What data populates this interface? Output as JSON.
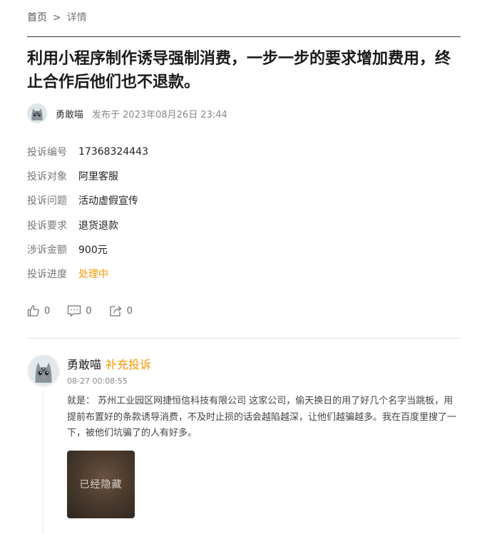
{
  "breadcrumb": {
    "home": "首页",
    "separator": ">",
    "current": "详情"
  },
  "title": "利用小程序制作诱导强制消费，一步一步的要求增加费用，终止合作后他们也不退款。",
  "author": {
    "name": "勇敢喵",
    "published_prefix": "发布于",
    "published_time": "2023年08月26日 23:44"
  },
  "info": [
    {
      "label": "投诉编号",
      "value": "17368324443"
    },
    {
      "label": "投诉对象",
      "value": "阿里客服"
    },
    {
      "label": "投诉问题",
      "value": "活动虚假宣传"
    },
    {
      "label": "投诉要求",
      "value": "退货退款"
    },
    {
      "label": "涉诉金额",
      "value": "900元"
    },
    {
      "label": "投诉进度",
      "value": "处理中"
    }
  ],
  "colors": {
    "accent_orange": "#f39800"
  },
  "actions": {
    "like_count": "0",
    "comment_count": "0",
    "share_count": "0"
  },
  "icons": {
    "like": "thumbs-up-icon",
    "comment": "comment-bubble-icon",
    "share": "share-icon",
    "avatar": "cat-avatar-icon"
  },
  "comment": {
    "name": "勇敢喵",
    "tag": "补充投诉",
    "time": "08-27 00:08:55",
    "text": "就是： 苏州工业园区网捷恒信科技有限公司 这家公司，偷天换日的用了好几个名字当跳板，用提前布置好的条款诱导消费，不及时止损的话会越陷越深，让他们越骗越多。我在百度里搜了一下，被他们坑骗了的人有好多。",
    "image_overlay": "已经隐藏"
  }
}
